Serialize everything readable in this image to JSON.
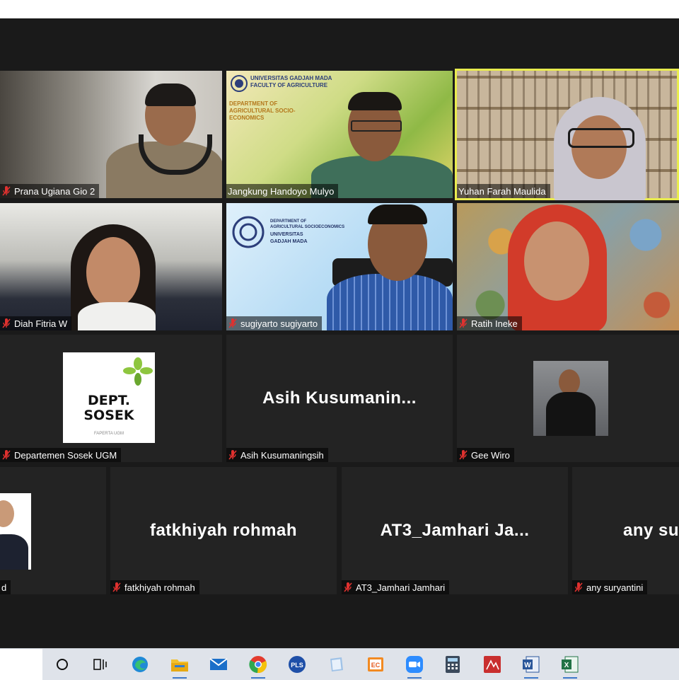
{
  "participants": [
    {
      "name": "Prana Ugiana Gio 2"
    },
    {
      "name": "Jangkung Handoyo Mulyo"
    },
    {
      "name": "Yuhan Farah Maulida"
    },
    {
      "name": "Diah Fitria W"
    },
    {
      "name": "sugiyarto sugiyarto"
    },
    {
      "name": "Ratih Ineke"
    },
    {
      "name": "Departemen Sosek UGM"
    },
    {
      "name": "Asih Kusumaningsih",
      "display": "Asih  Kusumanin..."
    },
    {
      "name": "Gee Wiro"
    },
    {
      "name": "d"
    },
    {
      "name": "fatkhiyah rohmah",
      "display": "fatkhiyah rohmah"
    },
    {
      "name": "AT3_Jamhari Jamhari",
      "display": "AT3_Jamhari  Ja..."
    },
    {
      "name": "any suryantini",
      "display": "any su"
    }
  ],
  "jangkung_background": {
    "university": "UNIVERSITAS GADJAH MADA",
    "faculty": "FACULTY OF AGRICULTURE",
    "department": "DEPARTMENT OF AGRICULTURAL SOCIO-ECONOMICS"
  },
  "sugiyarto_background": {
    "line1": "DEPARTMENT OF",
    "line2": "AGRICULTURAL SOCIOECONOMICS",
    "line3": "UNIVERSITAS",
    "line4": "GADJAH MADA"
  },
  "sosek_logo": {
    "line1": "DEPT.",
    "line2": "SOSEK",
    "sub": "FAPERTA UGM"
  },
  "taskbar": {
    "apps": [
      "search-circle",
      "task-view",
      "edge",
      "file-explorer",
      "mail",
      "chrome",
      "pls",
      "notes",
      "office",
      "zoom",
      "calculator",
      "pdf",
      "word",
      "excel"
    ],
    "pls_label": "PLS",
    "office_label": "EC",
    "word_label": "W",
    "excel_label": "X"
  },
  "colors": {
    "active_speaker": "#e9ec4e",
    "mute": "#e0312f",
    "taskbar": "#dfe3ea"
  }
}
